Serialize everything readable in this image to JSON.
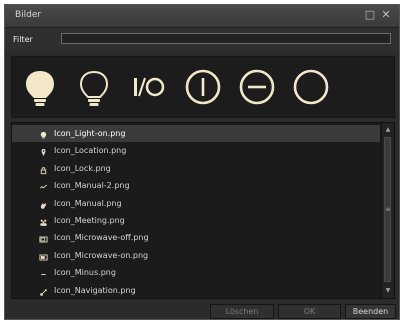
{
  "window": {
    "title": "Bilder",
    "buttons": {
      "restore_icon": "restore-icon",
      "close_icon": "close-icon"
    }
  },
  "filter": {
    "label": "Filter",
    "value": ""
  },
  "preview_icons": [
    "light-on-icon",
    "light-off-icon",
    "io-icon",
    "power-on-icon",
    "power-off-icon",
    "circle-icon"
  ],
  "list": {
    "items": [
      {
        "label": "Icon_Light-on.png",
        "icon": "light-on-icon",
        "selected": true
      },
      {
        "label": "Icon_Location.png",
        "icon": "location-icon",
        "selected": false
      },
      {
        "label": "Icon_Lock.png",
        "icon": "lock-icon",
        "selected": false
      },
      {
        "label": "Icon_Manual-2.png",
        "icon": "manual-2-icon",
        "selected": false
      },
      {
        "label": "Icon_Manual.png",
        "icon": "manual-icon",
        "selected": false
      },
      {
        "label": "Icon_Meeting.png",
        "icon": "meeting-icon",
        "selected": false
      },
      {
        "label": "Icon_Microwave-off.png",
        "icon": "microwave-off-icon",
        "selected": false
      },
      {
        "label": "Icon_Microwave-on.png",
        "icon": "microwave-on-icon",
        "selected": false
      },
      {
        "label": "Icon_Minus.png",
        "icon": "minus-icon",
        "selected": false
      },
      {
        "label": "Icon_Navigation.png",
        "icon": "navigation-icon",
        "selected": false
      }
    ]
  },
  "footer": {
    "delete_label": "Löschen",
    "ok_label": "OK",
    "quit_label": "Beenden"
  },
  "colors": {
    "window_bg": "#2b2b2b",
    "panel_bg": "#1b1b1b",
    "selection_bg": "#3a3a3a",
    "text": "#d4d4d4",
    "icon_cream": "#f2e8c8"
  }
}
